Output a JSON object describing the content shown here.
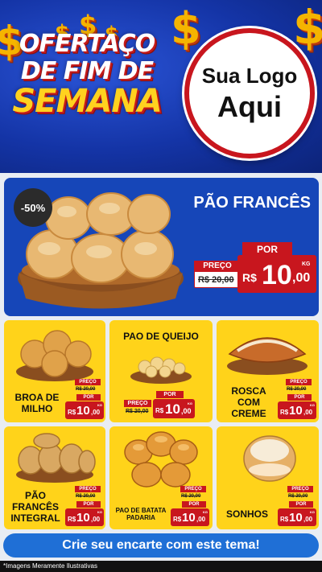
{
  "header": {
    "headline": [
      "OFERTAÇO",
      "DE FIM DE",
      "SEMANA"
    ],
    "logo": [
      "Sua Logo",
      "Aqui"
    ]
  },
  "featured": {
    "discount": "-50%",
    "name": "PÃO FRANCÊS",
    "por": "POR",
    "preco": "PREÇO",
    "old_price": "R$ 20,00",
    "currency": "R$",
    "price_int": "10",
    "price_dec": ",00",
    "unit": "KG"
  },
  "products": [
    {
      "name": "BROA DE MILHO",
      "old_price": "R$ 20,00",
      "price_int": "10",
      "price_dec": ",00"
    },
    {
      "name": "PAO DE QUEIJO",
      "old_price": "R$ 20,00",
      "price_int": "10",
      "price_dec": ",00"
    },
    {
      "name": "ROSCA COM CREME",
      "old_price": "R$ 20,00",
      "price_int": "10",
      "price_dec": ",00"
    },
    {
      "name": "PÃO FRANCÊS INTEGRAL",
      "old_price": "R$ 20,00",
      "price_int": "10",
      "price_dec": ",00"
    },
    {
      "name": "PAO DE BATATA PADARIA",
      "old_price": "R$ 20,00",
      "price_int": "10",
      "price_dec": ",00"
    },
    {
      "name": "SONHOS",
      "old_price": "R$ 20,00",
      "price_int": "10",
      "price_dec": ",00"
    }
  ],
  "labels": {
    "preco": "PREÇO",
    "por": "POR",
    "currency": "R$",
    "unit": "KG"
  },
  "cta": "Crie seu encarte com este tema!",
  "footer": "*Imagens Meramente Ilustrativas",
  "colors": {
    "blue": "#1646b8",
    "red": "#c8161e",
    "yellow": "#ffd31a",
    "cta": "#1f6fd6"
  }
}
